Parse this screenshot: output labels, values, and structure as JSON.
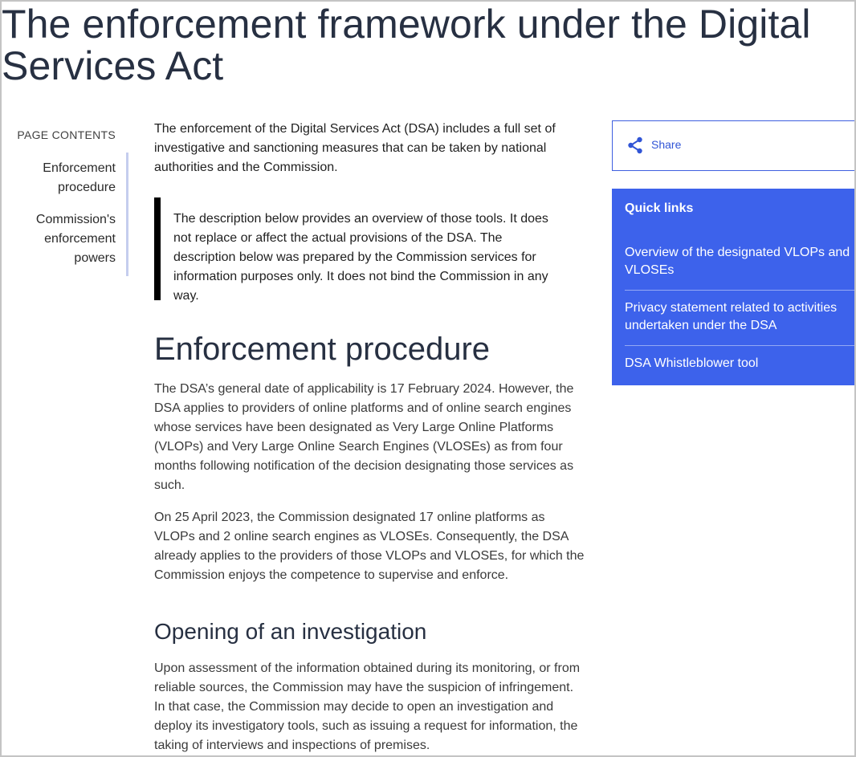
{
  "page": {
    "title": "The enforcement framework under the Digital Services Act"
  },
  "toc": {
    "heading": "PAGE CONTENTS",
    "items": [
      {
        "label": "Enforcement procedure"
      },
      {
        "label": "Commission's enforcement powers"
      }
    ]
  },
  "main": {
    "intro": "The enforcement of the Digital Services Act (DSA) includes a full set of investigative and sanctioning measures that can be taken by national authorities and the Commission.",
    "disclaimer": "The description below provides an overview of those tools. It does not replace or affect the actual provisions of the DSA. The description below was prepared by the Commission services for information purposes only. It does not bind the Commission in any way.",
    "section_heading": "Enforcement procedure",
    "para1": "The DSA’s general date of applicability is 17 February 2024. However, the DSA applies to providers of online platforms and of online search engines whose services have been designated as Very Large Online Platforms (VLOPs) and Very Large Online Search Engines (VLOSEs) as from four months following notification of the decision designating those services as such.",
    "para2": "On 25 April 2023, the Commission designated 17 online platforms as VLOPs and 2 online search engines as VLOSEs. Consequently, the DSA already applies to the providers of those VLOPs and VLOSEs, for which the Commission enjoys the competence to supervise and enforce.",
    "subsection_heading": "Opening of an investigation",
    "para3": "Upon assessment of the information obtained during its monitoring, or from reliable sources, the Commission may have the suspicion of infringement. In that case, the Commission may decide to open an investigation and deploy its investigatory tools, such as issuing a request for information, the taking of interviews and inspections of premises."
  },
  "share": {
    "label": "Share",
    "icon": "share-icon"
  },
  "quick_links": {
    "heading": "Quick links",
    "items": [
      {
        "label": "Overview of the designated VLOPs and VLOSEs"
      },
      {
        "label": "Privacy statement related to activities undertaken under the DSA"
      },
      {
        "label": "DSA Whistleblower tool"
      }
    ]
  },
  "colors": {
    "accent_blue": "#3d62eb",
    "share_text": "#3155d6",
    "toc_rule": "#c5cdee",
    "heading_text": "#273042"
  }
}
